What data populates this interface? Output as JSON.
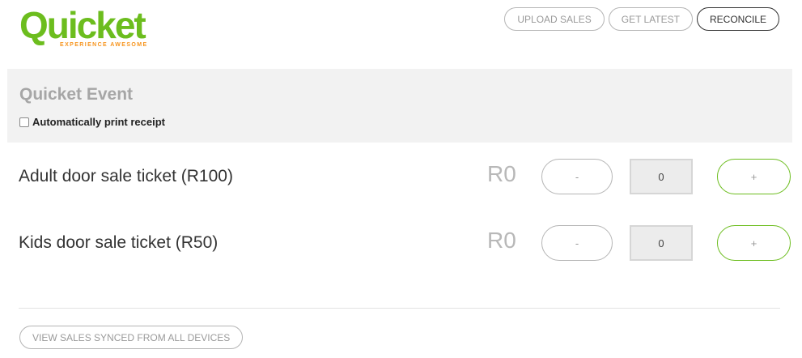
{
  "brand": {
    "name": "Quicket",
    "tagline": "EXPERIENCE AWESOME",
    "primary_color": "#6cbd1e",
    "accent_color": "#f7941d"
  },
  "toolbar": {
    "upload_sales_label": "UPLOAD SALES",
    "get_latest_label": "GET LATEST",
    "reconcile_label": "RECONCILE"
  },
  "event": {
    "title": "Quicket Event",
    "auto_print_label": "Automatically print receipt",
    "auto_print_checked": false
  },
  "tickets": [
    {
      "name": "Adult door sale ticket (R100)",
      "total": "R0",
      "minus_label": "-",
      "quantity": "0",
      "plus_label": "+"
    },
    {
      "name": "Kids door sale ticket (R50)",
      "total": "R0",
      "minus_label": "-",
      "quantity": "0",
      "plus_label": "+"
    }
  ],
  "footer": {
    "view_sales_label": "VIEW SALES SYNCED FROM ALL DEVICES"
  }
}
